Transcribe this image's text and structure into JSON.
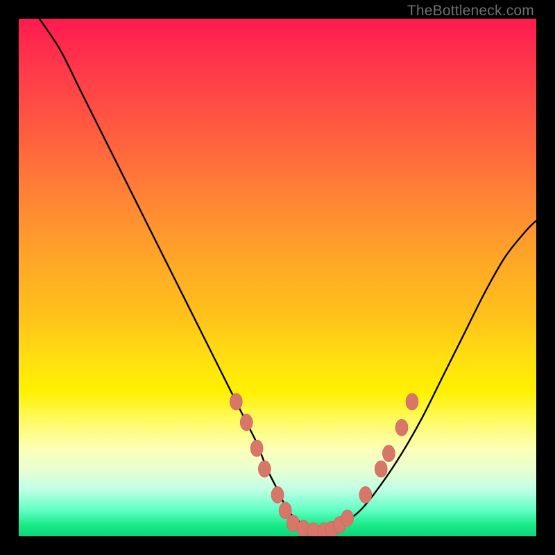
{
  "watermark": "TheBottleneck.com",
  "colors": {
    "frame": "#000000",
    "curve": "#000000",
    "marker": "#d8766a",
    "marker_stroke": "#c96558"
  },
  "chart_data": {
    "type": "line",
    "title": "",
    "xlabel": "",
    "ylabel": "",
    "xlim": [
      0,
      100
    ],
    "ylim": [
      0,
      100
    ],
    "grid": false,
    "legend": false,
    "series": [
      {
        "name": "bottleneck-curve",
        "x": [
          4,
          8,
          12,
          16,
          20,
          24,
          28,
          32,
          36,
          40,
          42,
          44,
          46,
          48,
          50,
          52,
          54,
          56,
          58,
          60,
          62,
          66,
          70,
          74,
          78,
          82,
          86,
          90,
          94,
          98,
          100
        ],
        "y": [
          100,
          94,
          86,
          78,
          70,
          62,
          54,
          46,
          38,
          30,
          26,
          22,
          18,
          13,
          9,
          5,
          3,
          1.5,
          1,
          1,
          2,
          5,
          10,
          16,
          23,
          31,
          39,
          47,
          54,
          59,
          61
        ]
      }
    ],
    "markers": {
      "name": "highlight-dots",
      "points": [
        {
          "x": 42,
          "y": 26
        },
        {
          "x": 44,
          "y": 22
        },
        {
          "x": 46,
          "y": 17
        },
        {
          "x": 47.5,
          "y": 13
        },
        {
          "x": 50,
          "y": 8
        },
        {
          "x": 51.5,
          "y": 5
        },
        {
          "x": 53,
          "y": 2.5
        },
        {
          "x": 55,
          "y": 1.5
        },
        {
          "x": 57,
          "y": 1
        },
        {
          "x": 59,
          "y": 1
        },
        {
          "x": 60.5,
          "y": 1.3
        },
        {
          "x": 62,
          "y": 2.2
        },
        {
          "x": 63.5,
          "y": 3.5
        },
        {
          "x": 67,
          "y": 8
        },
        {
          "x": 70,
          "y": 13
        },
        {
          "x": 71.5,
          "y": 16
        },
        {
          "x": 74,
          "y": 21
        },
        {
          "x": 76,
          "y": 26
        }
      ]
    }
  }
}
